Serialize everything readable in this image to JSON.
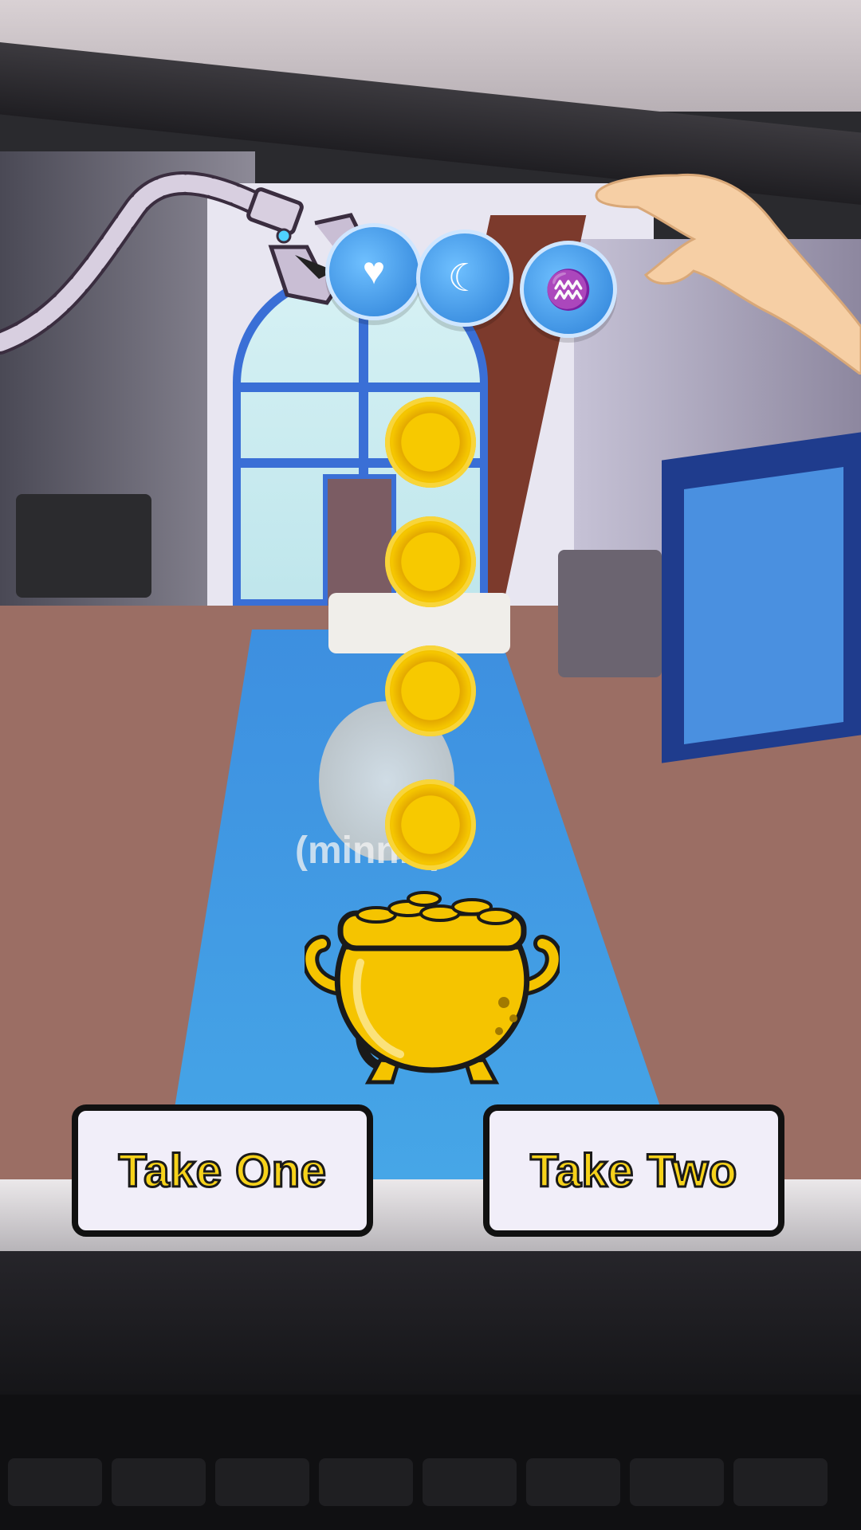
{
  "game": {
    "overlay_name_tag": "(minnie)"
  },
  "top_icons": [
    {
      "icon": "heart-rocket-icon",
      "glyph": "♥"
    },
    {
      "icon": "moon-icon",
      "glyph": "☾"
    },
    {
      "icon": "jellyfish-icon",
      "glyph": "♒"
    }
  ],
  "coins": [
    {
      "icon": "gold-coin-icon"
    },
    {
      "icon": "gold-coin-icon"
    },
    {
      "icon": "gold-coin-icon"
    },
    {
      "icon": "gold-coin-icon"
    }
  ],
  "pot": {
    "icon": "pot-of-gold-icon"
  },
  "buttons": {
    "take_one": "Take One",
    "take_two": "Take Two"
  },
  "colors": {
    "coin_gold": "#f5c400",
    "button_text": "#f6d21a",
    "button_bg": "#f1eef9",
    "button_border": "#111111",
    "icon_blue": "#2b7fd6"
  }
}
